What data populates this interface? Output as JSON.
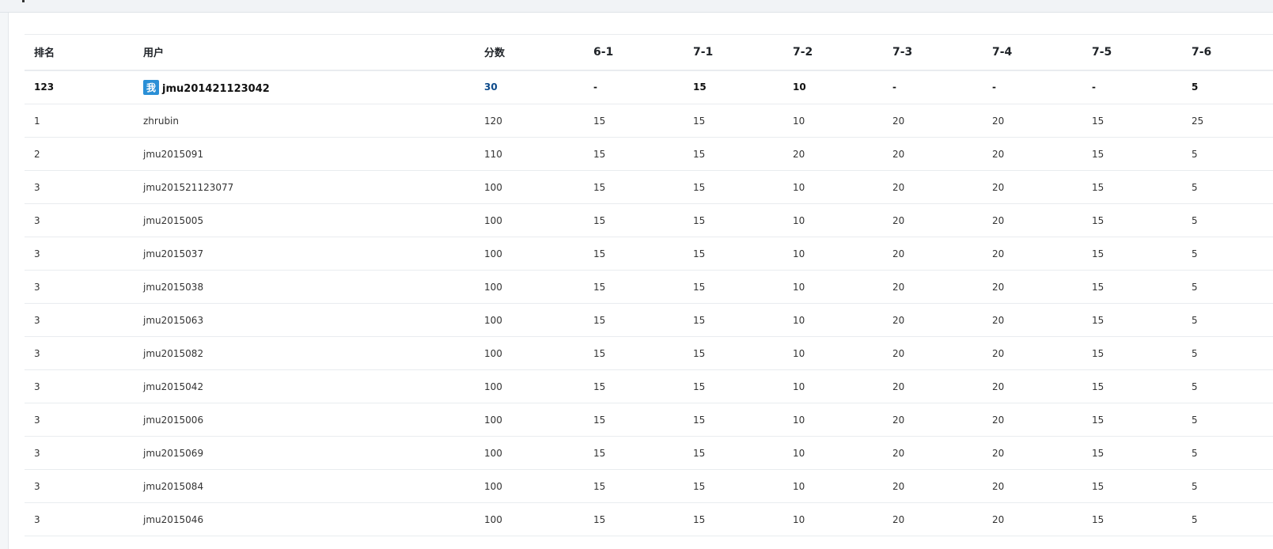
{
  "table": {
    "headers": {
      "rank": "排名",
      "user": "用户",
      "score": "分数",
      "problems": [
        "6-1",
        "7-1",
        "7-2",
        "7-3",
        "7-4",
        "7-5",
        "7-6"
      ]
    },
    "me": {
      "badge": "我",
      "rank": "123",
      "user": "jmu201421123042",
      "score": "30",
      "problems": [
        "-",
        "15",
        "10",
        "-",
        "-",
        "-",
        "5"
      ]
    },
    "rows": [
      {
        "rank": "1",
        "user": "zhrubin",
        "score": "120",
        "problems": [
          "15",
          "15",
          "10",
          "20",
          "20",
          "15",
          "25"
        ]
      },
      {
        "rank": "2",
        "user": "jmu2015091",
        "score": "110",
        "problems": [
          "15",
          "15",
          "20",
          "20",
          "20",
          "15",
          "5"
        ]
      },
      {
        "rank": "3",
        "user": "jmu201521123077",
        "score": "100",
        "problems": [
          "15",
          "15",
          "10",
          "20",
          "20",
          "15",
          "5"
        ]
      },
      {
        "rank": "3",
        "user": "jmu2015005",
        "score": "100",
        "problems": [
          "15",
          "15",
          "10",
          "20",
          "20",
          "15",
          "5"
        ]
      },
      {
        "rank": "3",
        "user": "jmu2015037",
        "score": "100",
        "problems": [
          "15",
          "15",
          "10",
          "20",
          "20",
          "15",
          "5"
        ]
      },
      {
        "rank": "3",
        "user": "jmu2015038",
        "score": "100",
        "problems": [
          "15",
          "15",
          "10",
          "20",
          "20",
          "15",
          "5"
        ]
      },
      {
        "rank": "3",
        "user": "jmu2015063",
        "score": "100",
        "problems": [
          "15",
          "15",
          "10",
          "20",
          "20",
          "15",
          "5"
        ]
      },
      {
        "rank": "3",
        "user": "jmu2015082",
        "score": "100",
        "problems": [
          "15",
          "15",
          "10",
          "20",
          "20",
          "15",
          "5"
        ]
      },
      {
        "rank": "3",
        "user": "jmu2015042",
        "score": "100",
        "problems": [
          "15",
          "15",
          "10",
          "20",
          "20",
          "15",
          "5"
        ]
      },
      {
        "rank": "3",
        "user": "jmu2015006",
        "score": "100",
        "problems": [
          "15",
          "15",
          "10",
          "20",
          "20",
          "15",
          "5"
        ]
      },
      {
        "rank": "3",
        "user": "jmu2015069",
        "score": "100",
        "problems": [
          "15",
          "15",
          "10",
          "20",
          "20",
          "15",
          "5"
        ]
      },
      {
        "rank": "3",
        "user": "jmu2015084",
        "score": "100",
        "problems": [
          "15",
          "15",
          "10",
          "20",
          "20",
          "15",
          "5"
        ]
      },
      {
        "rank": "3",
        "user": "jmu2015046",
        "score": "100",
        "problems": [
          "15",
          "15",
          "10",
          "20",
          "20",
          "15",
          "5"
        ]
      }
    ]
  }
}
